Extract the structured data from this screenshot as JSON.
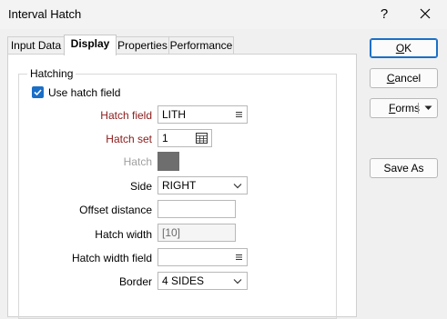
{
  "window": {
    "title": "Interval Hatch",
    "help_glyph": "?",
    "close_icon": "close-icon"
  },
  "tabs": [
    {
      "label": "Input Data",
      "active": false
    },
    {
      "label": "Display",
      "active": true
    },
    {
      "label": "Properties",
      "active": false
    },
    {
      "label": "Performance",
      "active": false
    }
  ],
  "hatching": {
    "group_label": "Hatching",
    "use_hatch_field": {
      "label": "Use hatch field",
      "checked": true
    },
    "hatch_field": {
      "label": "Hatch field",
      "value": "LITH",
      "icon": "list-icon"
    },
    "hatch_set": {
      "label": "Hatch set",
      "value": "1",
      "icon": "table-icon"
    },
    "hatch": {
      "label": "Hatch",
      "swatch_color": "#6e6e6e"
    },
    "side": {
      "label": "Side",
      "value": "RIGHT"
    },
    "offset_distance": {
      "label": "Offset distance",
      "value": ""
    },
    "hatch_width": {
      "label": "Hatch width",
      "value": "[10]"
    },
    "hatch_width_field": {
      "label": "Hatch width field",
      "value": "",
      "icon": "list-icon"
    },
    "border": {
      "label": "Border",
      "value": "4 SIDES"
    }
  },
  "buttons": {
    "ok": {
      "label": "OK",
      "mnemonic": "O",
      "rest": "K"
    },
    "cancel": {
      "label": "Cancel",
      "mnemonic": "C",
      "rest": "ancel"
    },
    "forms": {
      "label": "Forms",
      "mnemonic": "F",
      "rest": "orms"
    },
    "save_as": {
      "label": "Save As"
    }
  },
  "colors": {
    "accent": "#1a6fc7",
    "required_label": "#8b1a1a",
    "disabled_label": "#a0a0a0"
  }
}
